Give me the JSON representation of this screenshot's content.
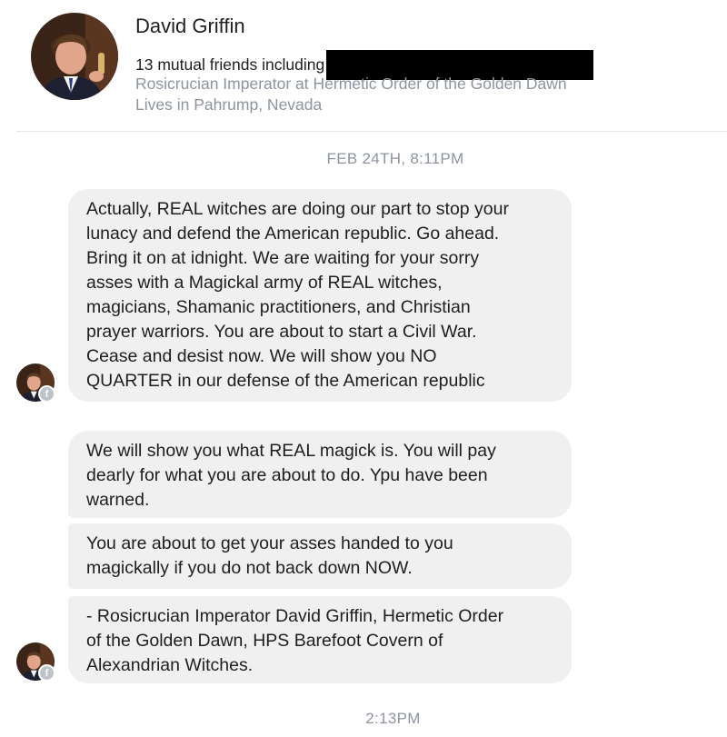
{
  "profile": {
    "name": "David Griffin",
    "mutual_friends": "13 mutual friends including",
    "work": "Rosicrucian Imperator at Hermetic Order of the Golden Dawn",
    "location": "Lives in Pahrump, Nevada"
  },
  "timestamps": {
    "first": "FEB 24TH, 8:11PM",
    "second": "2:13PM"
  },
  "messages": [
    {
      "text": "Actually, REAL witches are doing our part to stop your\nlunacy and defend the American republic. Go ahead.\nBring it on at idnight. We are waiting for your sorry\nasses with a Magickal army of REAL witches,\nmagicians, Shamanic practitioners, and Christian\nprayer warriors. You are about to start a Civil War.\nCease and desist now. We will show you NO\nQUARTER in our defense of the American republic"
    },
    {
      "text": "We will show you what REAL magick is. You will pay\ndearly for what you are about to do. Ypu have been\nwarned."
    },
    {
      "text": "You are about to get your asses handed to you\nmagickally if you do not back down NOW."
    },
    {
      "text": "- Rosicrucian Imperator David Griffin, Hermetic Order\nof the Golden Dawn, HPS Barefoot Covern of\nAlexandrian Witches."
    }
  ],
  "badge_glyph": "f",
  "colors": {
    "bubble": "#f1f0f0",
    "secondary_text": "#8d949e",
    "redaction": "#000000"
  },
  "icons": {
    "profile_photo": "profile-photo",
    "messenger_badge": "facebook-badge-icon"
  }
}
